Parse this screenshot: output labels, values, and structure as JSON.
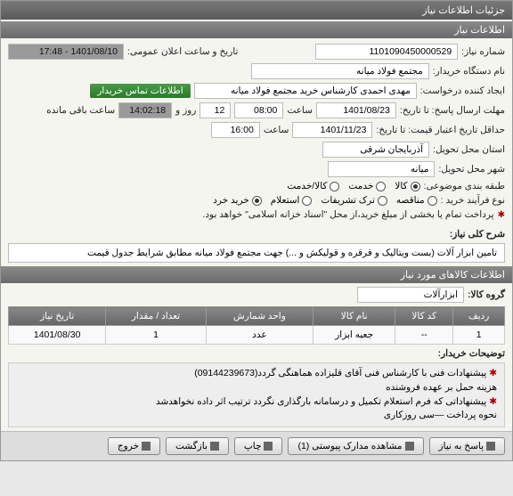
{
  "window_title": "جزئیات اطلاعات نیاز",
  "section1_title": "اطلاعات نیاز",
  "labels": {
    "need_no": "شماره نیاز:",
    "public_date": "تاریخ و ساعت اعلان عمومی:",
    "buyer_org": "نام دستگاه خریدار:",
    "requester": "ایجاد کننده درخواست:",
    "contact_btn": "اطلاعات تماس خریدار",
    "reply_deadline": "مهلت ارسال پاسخ: تا تاریخ:",
    "hour": "ساعت",
    "days_and": "روز و",
    "remain": "ساعت باقی مانده",
    "price_valid": "حداقل تاریخ اعتبار قیمت: تا تاریخ:",
    "province": "استان محل تحویل:",
    "city": "شهر محل تحویل:",
    "category": "طبقه بندی موضوعی:",
    "buy_process": "نوع فرآیند خرید :",
    "pay_note": "پرداخت تمام یا بخشی از مبلغ خرید،از محل \"اسناد خزانه اسلامی\" خواهد بود.",
    "need_desc_label": "شرح کلی نیاز:",
    "section2": "اطلاعات کالاهای مورد نیاز",
    "goods_group": "گروه کالا:",
    "buyer_notes": "توضیحات خریدار:"
  },
  "values": {
    "need_no": "1101090450000529",
    "public_date": "1401/08/10 - 17:48",
    "buyer_org": "مجتمع فولاد میانه",
    "requester": "مهدی احمدی کارشناس خرید مجتمع فولاد میانه",
    "reply_date": "1401/08/23",
    "reply_time": "08:00",
    "remain_days": "12",
    "remain_time": "14:02:18",
    "price_date": "1401/11/23",
    "price_time": "16:00",
    "province": "آذربایجان شرقی",
    "city": "میانه",
    "goods_group": "ابزارآلات",
    "need_desc": "تامین ابزار آلات (بست ویتالیک و قرقره و قولیکش و ...) جهت مجتمع فولاد میانه مطابق شرایط جدول قیمت"
  },
  "radios": {
    "cat": [
      "کالا",
      "خدمت",
      "کالا/خدمت"
    ],
    "cat_sel": 0,
    "proc": [
      "مناقصه",
      "ترک تشریفات",
      "استعلام",
      "خرید خرد"
    ],
    "proc_sel": 3
  },
  "table": {
    "headers": [
      "ردیف",
      "کد کالا",
      "نام کالا",
      "واحد شمارش",
      "تعداد / مقدار",
      "تاریخ نیاز"
    ],
    "rows": [
      [
        "1",
        "--",
        "جعبه ابزار",
        "عدد",
        "1",
        "1401/08/30"
      ]
    ]
  },
  "notes": [
    "پیشنهادات فنی با کارشناس فنی آقای قلیزاده هماهنگی گردد(09144239673)",
    "هزینه حمل بر عهده فروشنده",
    "پیشنهاداتی که فرم استعلام تکمیل و درسامانه بارگذاری نگردد ترتیب اثر داده نخواهدشد",
    "نحوه پرداخت —سی روزکاری"
  ],
  "buttons": {
    "reply": "پاسخ به نیاز",
    "attach": "مشاهده مدارک پیوستی (1)",
    "print": "چاپ",
    "back": "بازگشت",
    "exit": "خروج"
  }
}
